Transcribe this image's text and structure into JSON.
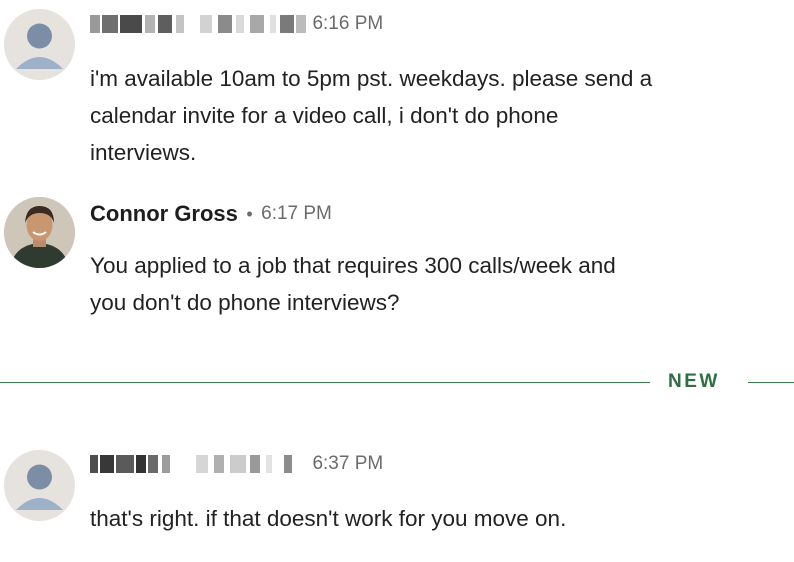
{
  "messages": [
    {
      "author": "",
      "author_redacted": true,
      "time": "6:16 PM",
      "lines": [
        "i'm available 10am to 5pm pst. weekdays. please send a",
        "calendar invite for a video call, i don't do phone",
        "interviews."
      ]
    },
    {
      "author": "Connor Gross",
      "author_redacted": false,
      "separator": "•",
      "time": "6:17 PM",
      "lines": [
        "You applied to a job that requires 300 calls/week and",
        "you don't do phone interviews?"
      ]
    },
    {
      "author": "",
      "author_redacted": true,
      "time": "6:37 PM",
      "lines": [
        "that's right. if that doesn't work for you move on."
      ]
    }
  ],
  "divider": {
    "label": "NEW",
    "color": "#2f6f44"
  },
  "colors": {
    "avatar_generic_bg": "#e6e3df",
    "avatar_generic_fg": "#8194ab",
    "timestamp": "#6b6b6b"
  }
}
